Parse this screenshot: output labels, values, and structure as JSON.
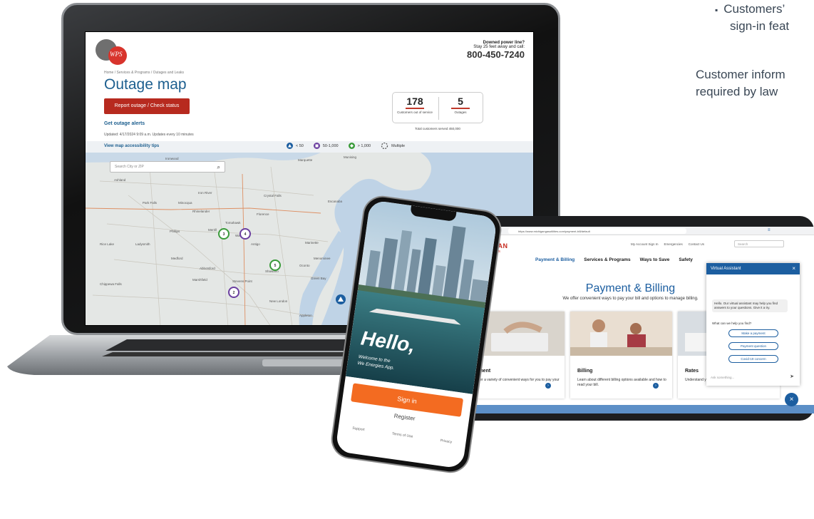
{
  "side_text": {
    "bullet": "Customers’",
    "bullet_cont": "sign-in feat",
    "para_line1": "Customer inform",
    "para_line2": "required by law"
  },
  "laptop": {
    "logo_text": "WPS",
    "downed_title": "Downed power line?",
    "downed_sub": "Stay 25 feet away and call:",
    "downed_phone": "800-450-7240",
    "breadcrumb": "Home / Services & Programs / Outages and Leaks",
    "page_title": "Outage map",
    "report_button": "Report outage / Check status",
    "alerts_link": "Get outage alerts",
    "updated": "Updated: 4/17/2024 9:09 a.m.   Updates every 10 minutes",
    "stat_customers": "178",
    "stat_customers_label": "Customers out of service",
    "stat_outages": "5",
    "stat_outages_label": "Outages",
    "served": "Total customers served 450,000",
    "accessibility_link": "View map accessibility tips",
    "legend": [
      "< 50",
      "50-1,000",
      "> 1,000",
      "Multiple"
    ],
    "legend_colors": [
      "#1c5ea0",
      "#6b3fa0",
      "#3a9b3a",
      "#555555"
    ],
    "search_placeholder": "Search City or ZIP",
    "map_places": [
      "Ironwood",
      "Marquette",
      "Munising",
      "Escanaba",
      "Iron River",
      "Crystal Falls",
      "Florence",
      "Rhinelander",
      "Wausau",
      "Marinette",
      "Green Bay",
      "Menominee",
      "Merrill",
      "Antigo",
      "Shawano",
      "Oconto",
      "Sturgeon Bay",
      "Stevens Point",
      "Marshfield",
      "New London",
      "Appleton",
      "Ashland",
      "Park Falls",
      "Tomahawk",
      "Minocqua",
      "Phillips",
      "Medford",
      "Abbotsford",
      "Ladysmith",
      "Rice Lake",
      "Chippewa Falls"
    ],
    "map_markers": [
      "3",
      "4",
      "5",
      "2",
      "2",
      "3"
    ]
  },
  "tablet": {
    "url": "https://www.michigangasutilities.com/payment-bill/default",
    "logo_line1": "MICHIGAN",
    "logo_line2": "GAS UTILITIES",
    "topnav": [
      "My Account Sign In",
      "Emergencies",
      "Contact Us"
    ],
    "search_placeholder": "Search",
    "mainnav": [
      "Payment & Billing",
      "Services & Programs",
      "Ways to Save",
      "Safety"
    ],
    "home_crumb": "Home",
    "title": "Payment & Billing",
    "subtitle": "We offer convenient ways to pay your bill and options to manage billing.",
    "cards": [
      {
        "title": "Payment",
        "desc": "We offer a variety of convenient ways for you to pay your bill."
      },
      {
        "title": "Billing",
        "desc": "Learn about different billing options available and how to read your bill."
      },
      {
        "title": "Rates",
        "desc": "Understand your monthly charges."
      }
    ],
    "va_title": "Virtual Assistant",
    "va_message": "Hello. Our virtual assistant may help you find answers to your questions. Give it a try.",
    "va_question": "What can we help you find?",
    "va_options": [
      "Make a payment",
      "Payment question",
      "Covid-19 concern"
    ],
    "va_input": "Ask something...",
    "fab_icon": "close-icon"
  },
  "phone": {
    "hello": "Hello,",
    "welcome_line1": "Welcome to the",
    "welcome_line2": "We Energies App.",
    "signin": "Sign in",
    "register": "Register",
    "footer": [
      "Support",
      "Terms of Use",
      "Privacy"
    ]
  }
}
